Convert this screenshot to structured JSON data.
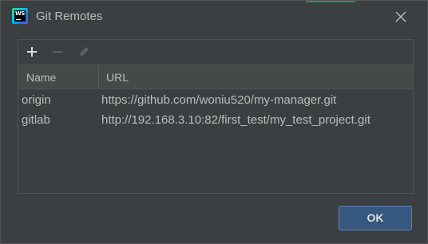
{
  "window": {
    "title": "Git Remotes",
    "app_icon": "webstorm-icon",
    "app_icon_text": "WS"
  },
  "toolbar": {
    "add_icon": "plus-icon",
    "remove_icon": "minus-icon",
    "edit_icon": "pencil-icon"
  },
  "table": {
    "columns": [
      "Name",
      "URL"
    ],
    "rows": [
      {
        "name": "origin",
        "url": "https://github.com/woniu520/my-manager.git"
      },
      {
        "name": "gitlab",
        "url": "http://192.168.3.10:82/first_test/my_test_project.git"
      }
    ]
  },
  "buttons": {
    "ok_label": "OK"
  },
  "colors": {
    "dialog_bg": "#3c3f41",
    "text": "#bbbbbb",
    "primary_button": "#365880",
    "header_bg": "#45494a"
  }
}
